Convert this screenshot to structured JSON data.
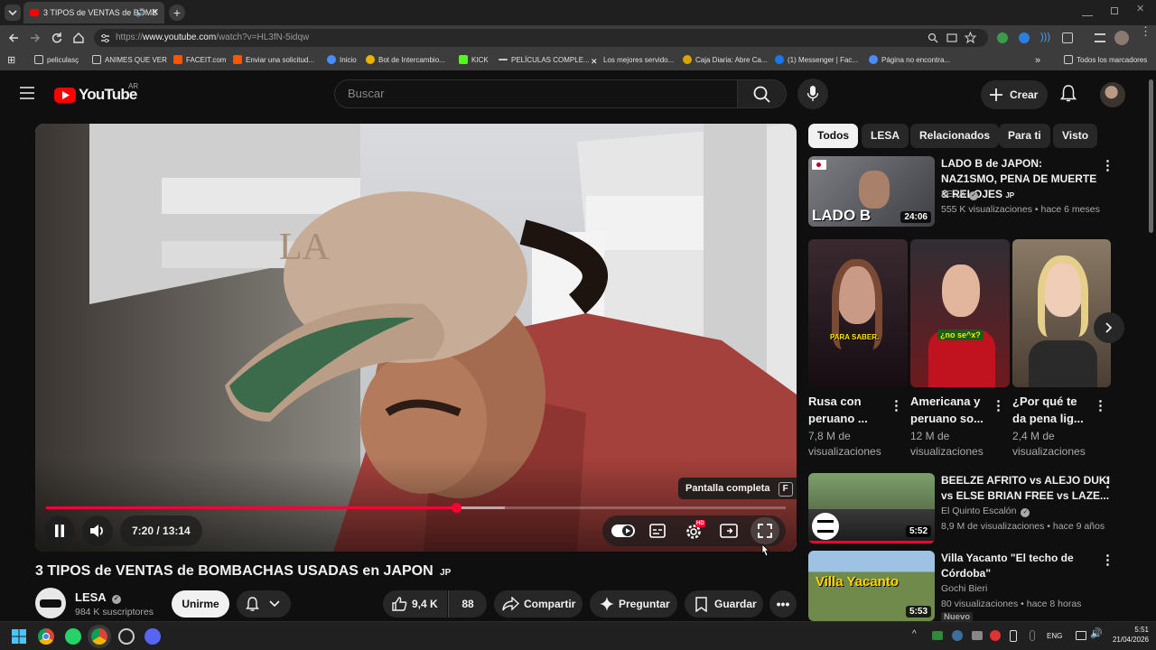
{
  "browser": {
    "tab_title": "3 TIPOS de VENTAS de BOMB",
    "url_prefix": "https://",
    "url_domain": "www.youtube.com",
    "url_path": "/watch?v=HL3fN-5idqw",
    "bookmarks": [
      "peliculasç",
      "ANIMES QUE VER",
      "FACEIT.com",
      "Enviar una solicitud...",
      "Inicio",
      "Bot de Intercambio...",
      "KICK",
      "PELÍCULAS COMPLE...",
      "Los mejores servido...",
      "Caja Diaria: Abre Ca...",
      "(1) Messenger | Fac...",
      "Página no encontra..."
    ],
    "all_bookmarks": "Todos los marcadores"
  },
  "yt": {
    "logo": "YouTube",
    "region": "AR",
    "search_placeholder": "Buscar",
    "create_label": "Crear"
  },
  "player": {
    "time": "7:20 / 13:14",
    "progress": 0.554,
    "tooltip": "Pantalla completa",
    "tooltip_key": "F",
    "hd_badge": "HD"
  },
  "video": {
    "title": "3 TIPOS de VENTAS de BOMBACHAS USADAS en JAPON",
    "title_flag": "JP",
    "channel": "LESA",
    "subscribers": "984 K suscriptores",
    "join": "Unirme",
    "likes": "9,4 K",
    "dislikes": "88",
    "share": "Compartir",
    "ask": "Preguntar",
    "save": "Guardar"
  },
  "chips": [
    "Todos",
    "LESA",
    "Relacionados",
    "Para ti",
    "Visto"
  ],
  "rec1": {
    "title": "LADO B de JAPON: NAZ1SMO, PENA DE MUERTE & RELOJES",
    "flag": "JP",
    "channel": "LESA",
    "meta": "555 K visualizaciones • hace 6 meses",
    "duration": "24:06",
    "thumb_text": "LADO B"
  },
  "shorts": [
    {
      "title1": "Rusa con",
      "title2": "peruano ...",
      "views1": "7,8 M de",
      "views2": "visualizaciones",
      "caption": "PARA SABER."
    },
    {
      "title1": "Americana y",
      "title2": "peruano so...",
      "views1": "12 M de",
      "views2": "visualizaciones",
      "caption": "¿no se^x?"
    },
    {
      "title1": "¿Por qué te",
      "title2": "da pena lig...",
      "views1": "2,4 M de",
      "views2": "visualizaciones",
      "caption": ""
    }
  ],
  "rec2": {
    "title1": "BEELZE AFRITO vs ALEJO DUKI",
    "title2": "vs ELSE BRIAN FREE vs LAZE...",
    "channel": "El Quinto Escalón",
    "meta": "8,9 M de visualizaciones • hace 9 años",
    "duration": "5:52"
  },
  "rec3": {
    "title1": "Villa Yacanto \"El techo de",
    "title2": "Córdoba\"",
    "channel": "Gochi Bieri",
    "meta": "80 visualizaciones • hace 8 horas",
    "badge": "Nuevo",
    "duration": "5:53",
    "thumb_text": "Villa Yacanto"
  },
  "taskbar": {
    "lang": "ENG",
    "time": "5:51",
    "date": "21/04/2026"
  },
  "colors": {
    "yt_red": "#ff0000",
    "progress_red": "#ff0033",
    "bg": "#0f0f0f"
  }
}
